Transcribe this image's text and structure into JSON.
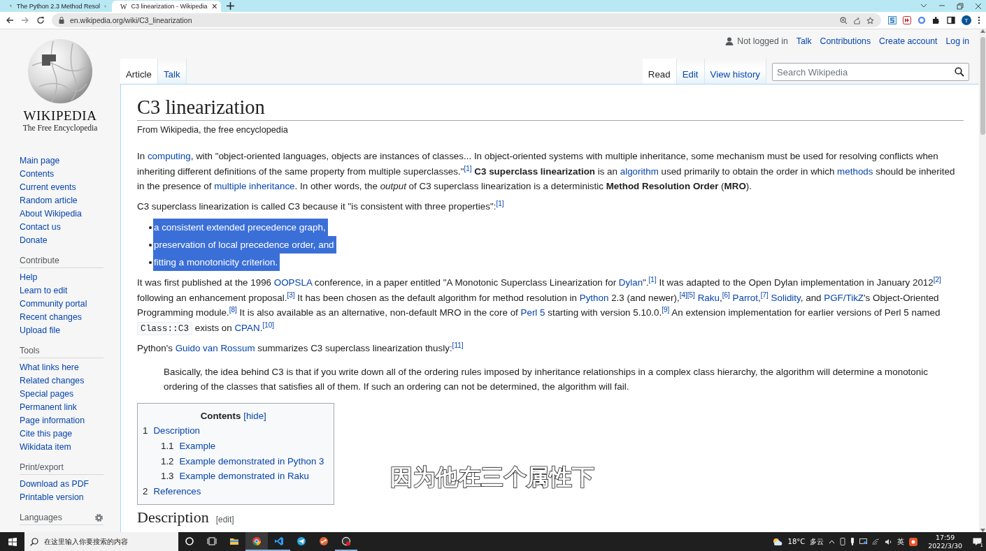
{
  "browser": {
    "tabs": [
      {
        "title": "The Python 2.3 Method Resol",
        "selected": false
      },
      {
        "title": "C3 linearization - Wikipedia",
        "favicon": "W",
        "selected": true
      }
    ],
    "address": "en.wikipedia.org/wiki/C3_linearization",
    "profile": "T"
  },
  "wiki": {
    "logo": {
      "wordmark": "WIKIPEDIA",
      "tagline": "The Free Encyclopedia"
    },
    "sidebar": {
      "main": [
        "Main page",
        "Contents",
        "Current events",
        "Random article",
        "About Wikipedia",
        "Contact us",
        "Donate"
      ],
      "sections": [
        {
          "heading": "Contribute",
          "items": [
            "Help",
            "Learn to edit",
            "Community portal",
            "Recent changes",
            "Upload file"
          ]
        },
        {
          "heading": "Tools",
          "items": [
            "What links here",
            "Related changes",
            "Special pages",
            "Permanent link",
            "Page information",
            "Cite this page",
            "Wikidata item"
          ]
        },
        {
          "heading": "Print/export",
          "items": [
            "Download as PDF",
            "Printable version"
          ]
        }
      ],
      "languages": "Languages"
    },
    "user_status": "Not logged in",
    "user_links": [
      "Talk",
      "Contributions",
      "Create account",
      "Log in"
    ],
    "left_tabs": [
      {
        "label": "Article",
        "selected": true
      },
      {
        "label": "Talk",
        "selected": false
      }
    ],
    "right_tabs": [
      {
        "label": "Read",
        "selected": true
      },
      {
        "label": "Edit",
        "selected": false
      },
      {
        "label": "View history",
        "selected": false
      }
    ],
    "search": {
      "placeholder": "Search Wikipedia"
    },
    "title": "C3 linearization",
    "subtitle": "From Wikipedia, the free encyclopedia",
    "blocks": [
      {
        "kind": "para",
        "segments": [
          {
            "kind": "text",
            "text": "In "
          },
          {
            "kind": "link",
            "text": "computing"
          },
          {
            "kind": "text",
            "text": ", with \"object-oriented languages, objects are instances of classes... In object-oriented systems with multiple inheritance, some mechanism must be used for resolving conflicts when inheriting different definitions of the same property from multiple superclasses.\"$^{[1]}$ **C3 superclass linearization** is an "
          },
          {
            "kind": "link",
            "text": "algorithm"
          },
          {
            "kind": "text",
            "text": " used primarily to obtain the order in which "
          },
          {
            "kind": "link",
            "text": "methods"
          },
          {
            "kind": "text",
            "text": " should be inherited in the presence of "
          },
          {
            "kind": "link",
            "text": "multiple inheritance"
          },
          {
            "kind": "text",
            "text": ". In other words, the *output* of C3 superclass linearization is a deterministic **Method Resolution Order** (**MRO**)."
          }
        ]
      },
      {
        "kind": "para",
        "segments": [
          {
            "kind": "text",
            "text": "C3 superclass linearization is called C3 because it \"is consistent with three properties\":$^{[1]}$"
          }
        ]
      },
      {
        "kind": "list",
        "items": [
          {
            "text": "a consistent extended precedence graph,",
            "selected": true
          },
          {
            "text": "preservation of local precedence order, and",
            "selected": true
          },
          {
            "text": "fitting a monotonicity criterion.",
            "selected": true
          }
        ]
      },
      {
        "kind": "para",
        "segments": [
          {
            "kind": "text",
            "text": "It was first published at the 1996 "
          },
          {
            "kind": "link",
            "text": "OOPSLA"
          },
          {
            "kind": "text",
            "text": " conference, in a paper entitled \"A Monotonic Superclass Linearization for "
          },
          {
            "kind": "link",
            "text": "Dylan"
          },
          {
            "kind": "text",
            "text": "\".$^{[1]}$ It was adapted to the Open Dylan implementation in January 2012$^{[2]}$ following an enhancement proposal.$^{[3]}$ It has been chosen as the default algorithm for method resolution in "
          },
          {
            "kind": "link",
            "text": "Python"
          },
          {
            "kind": "text",
            "text": " 2.3 (and newer),$^{[4][5]}$ "
          },
          {
            "kind": "link",
            "text": "Raku"
          },
          {
            "kind": "text",
            "text": ",$^{[6]}$ "
          },
          {
            "kind": "link",
            "text": "Parrot"
          },
          {
            "kind": "text",
            "text": ",$^{[7]}$ "
          },
          {
            "kind": "link",
            "text": "Solidity"
          },
          {
            "kind": "text",
            "text": ", and "
          },
          {
            "kind": "link",
            "text": "PGF/TikZ"
          },
          {
            "kind": "text",
            "text": "'s Object-Oriented Programming module.$^{[8]}$ It is also available as an alternative, non-default MRO in the core of "
          },
          {
            "kind": "link",
            "text": "Perl 5"
          },
          {
            "kind": "text",
            "text": " starting with version 5.10.0.$^{[9]}$ An extension implementation for earlier versions of Perl 5 named "
          },
          {
            "kind": "code",
            "text": "Class::C3"
          },
          {
            "kind": "text",
            "text": " exists on "
          },
          {
            "kind": "link",
            "text": "CPAN"
          },
          {
            "kind": "text",
            "text": ".$^{[10]}$"
          }
        ]
      },
      {
        "kind": "para",
        "segments": [
          {
            "kind": "text",
            "text": "Python's "
          },
          {
            "kind": "link",
            "text": "Guido van Rossum"
          },
          {
            "kind": "text",
            "text": " summarizes C3 superclass linearization thusly:$^{[11]}$"
          }
        ]
      },
      {
        "kind": "quote",
        "text": "Basically, the idea behind C3 is that if you write down all of the ordering rules imposed by inheritance relationships in a complex class hierarchy, the algorithm will determine a monotonic ordering of the classes that satisfies all of them. If such an ordering can not be determined, the algorithm will fail."
      }
    ],
    "toc": {
      "title": "Contents",
      "toggle": "[hide]",
      "entries": [
        {
          "number": "1",
          "label": "Description",
          "children": [
            {
              "number": "1.1",
              "label": "Example"
            },
            {
              "number": "1.2",
              "label": "Example demonstrated in Python 3"
            },
            {
              "number": "1.3",
              "label": "Example demonstrated in Raku"
            }
          ]
        },
        {
          "number": "2",
          "label": "References"
        }
      ]
    },
    "section": {
      "title": "Description",
      "edit": "[edit]"
    }
  },
  "caption": "因为他在三个属性下",
  "taskbar": {
    "search_placeholder": "在这里输入你要搜索的内容",
    "apps": [
      {
        "kind": "cortana",
        "selected": false,
        "running": false
      },
      {
        "kind": "taskview",
        "selected": false,
        "running": false
      },
      {
        "kind": "folder",
        "selected": false,
        "running": false
      },
      {
        "kind": "chrome",
        "selected": true,
        "running": true
      },
      {
        "kind": "vscode",
        "selected": false,
        "running": true
      },
      {
        "kind": "telegram",
        "selected": false,
        "running": false
      },
      {
        "kind": "remote",
        "selected": false,
        "running": false
      },
      {
        "kind": "recorder",
        "selected": false,
        "running": true
      }
    ],
    "temperature": "18°C",
    "condition": "多云",
    "ime": "英",
    "time": "17:59",
    "date": "2022/3/30",
    "notifications": "1"
  }
}
